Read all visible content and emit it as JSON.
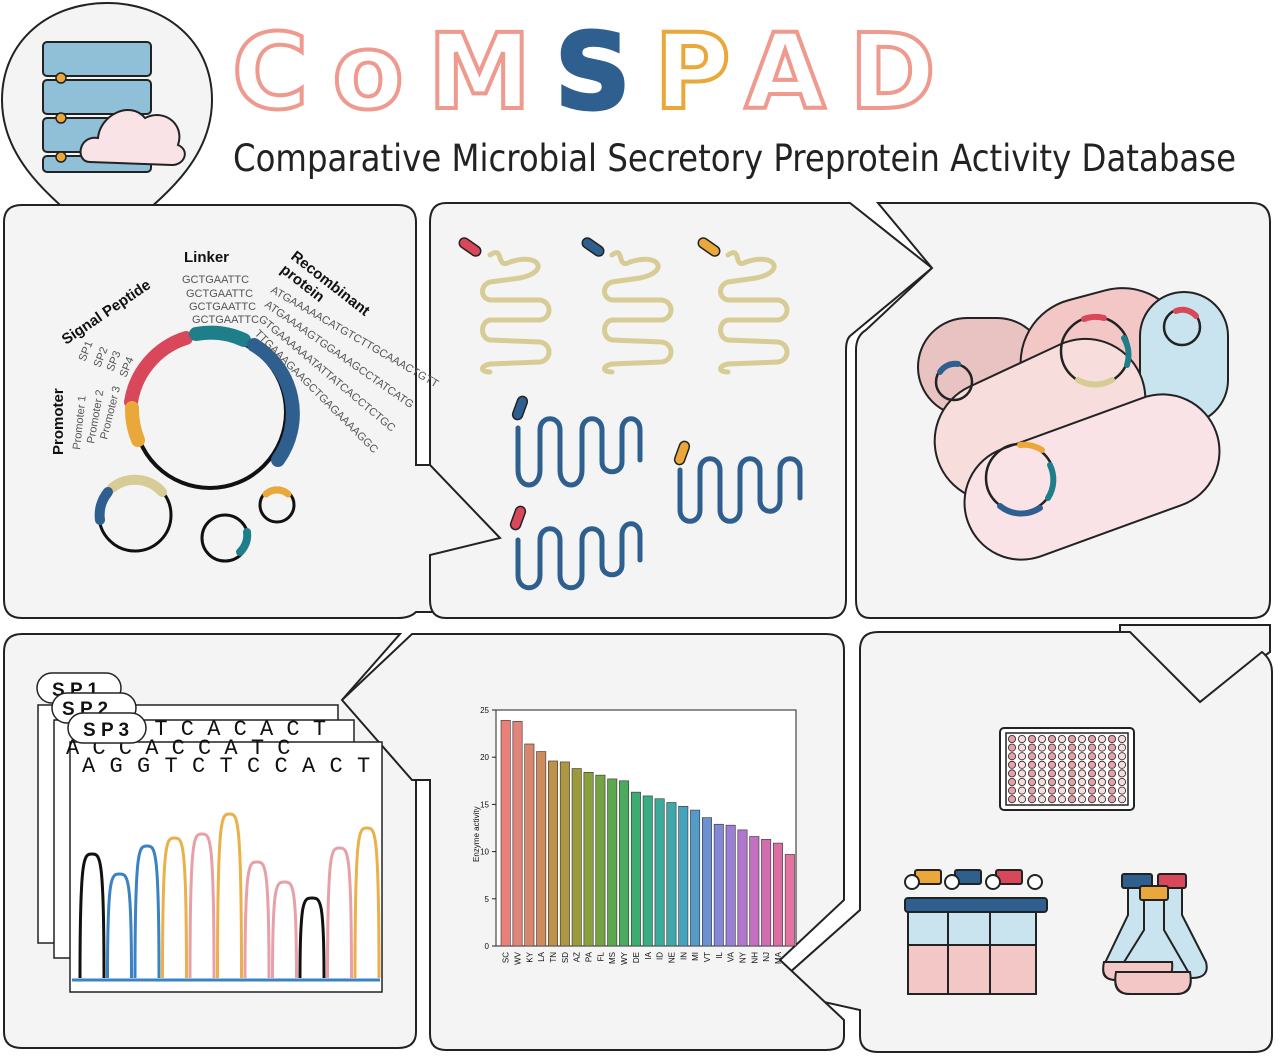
{
  "header": {
    "title_letters": [
      {
        "ch": "C",
        "color": "#ee9a8e"
      },
      {
        "ch": "o",
        "color": "#ee9a8e"
      },
      {
        "ch": "M",
        "color": "#ee9a8e"
      },
      {
        "ch": "S",
        "color": "#2f5f8f"
      },
      {
        "ch": "P",
        "color": "#eaa83a"
      },
      {
        "ch": "A",
        "color": "#ee9a8e"
      },
      {
        "ch": "D",
        "color": "#ee9a8e"
      }
    ],
    "subtitle": "Comparative Microbial Secretory Preprotein Activity Database"
  },
  "plasmid_panel": {
    "linker_label": "Linker",
    "linker_seqs": [
      "GCTGAATTC",
      "GCTGAATTC",
      "GCTGAATTC",
      "GCTGAATTC"
    ],
    "signal_label": "Signal Peptide",
    "signal_items": [
      "SP1",
      "SP2",
      "SP3",
      "SP4"
    ],
    "recombinant_label": "Recombinant\nprotein",
    "recombinant_label_lines": [
      "Recombinant",
      "protein"
    ],
    "recombinant_seqs": [
      "ATGAAAAACATGTCTTGCAAACTGTT",
      "ATGAAAAGTGGAAAGCCTATCATG",
      "GTGAAAAAATATTATCACCTCTGC",
      "TTGAAAGAAGCTGAGAAAAGGC"
    ],
    "promoter_label": "Promoter",
    "promoter_items": [
      "Promoter 1",
      "Promoter 2",
      "Promoter 3"
    ]
  },
  "sequencing_panel": {
    "tags": [
      "SP1",
      "SP2",
      "SP3"
    ],
    "tag_display": [
      "S P 1",
      "S P 2",
      "S P 3"
    ],
    "back_sequence_1": "A  T  C  A  C  A  C  T",
    "back_sequence_2": "A  C  C  A  C  C  A  T  C",
    "front_sequence": "A G G T C T C C A C T",
    "front_bases": [
      "A",
      "G",
      "G",
      "T",
      "C",
      "T",
      "C",
      "C",
      "A",
      "C",
      "T"
    ],
    "trace_colors": {
      "A": "#111111",
      "C": "#e8a0a8",
      "G": "#3a82c4",
      "T": "#eab04a"
    }
  },
  "chart_data": {
    "type": "bar",
    "ylabel": "Enzyme activity",
    "xlabel": "",
    "ylim": [
      0,
      25
    ],
    "yticks": [
      0,
      5,
      10,
      15,
      20,
      25
    ],
    "categories": [
      "SC",
      "WV",
      "KY",
      "LA",
      "TN",
      "SD",
      "AZ",
      "PA",
      "FL",
      "MS",
      "WY",
      "DE",
      "IA",
      "ID",
      "NE",
      "IN",
      "MI",
      "VT",
      "IL",
      "VA",
      "NY",
      "NH",
      "NJ",
      "MA"
    ],
    "values": [
      23.9,
      23.8,
      21.4,
      20.6,
      19.6,
      19.5,
      18.8,
      18.4,
      18.1,
      17.7,
      17.5,
      16.3,
      15.9,
      15.6,
      15.2,
      14.8,
      14.4,
      13.6,
      12.9,
      12.8,
      12.3,
      11.6,
      11.3,
      10.9,
      9.7
    ],
    "bar_colors": [
      "#e9807a",
      "#e3847a",
      "#d8876d",
      "#cc8c5d",
      "#be914c",
      "#ae9643",
      "#9d9a3e",
      "#8a9f3e",
      "#74a344",
      "#5ea74f",
      "#4aaa5e",
      "#3eac70",
      "#3aac84",
      "#3baa98",
      "#3fa7aa",
      "#47a2bb",
      "#569ac8",
      "#6b91d1",
      "#8288d5",
      "#9a7fd4",
      "#b076cd",
      "#c271c1",
      "#d06eb2",
      "#da6fa2",
      "#e174a0"
    ]
  },
  "colors": {
    "panel_fill": "#f4f4f4",
    "panel_stroke": "#222222",
    "pink": "#ee9a8e",
    "blue": "#2f5f8f",
    "teal": "#1e7f8a",
    "red": "#d9475a",
    "orange": "#eaa83a",
    "beige": "#d8cc96",
    "light_pink": "#f7dedd",
    "light_blue": "#c9e4ef"
  }
}
